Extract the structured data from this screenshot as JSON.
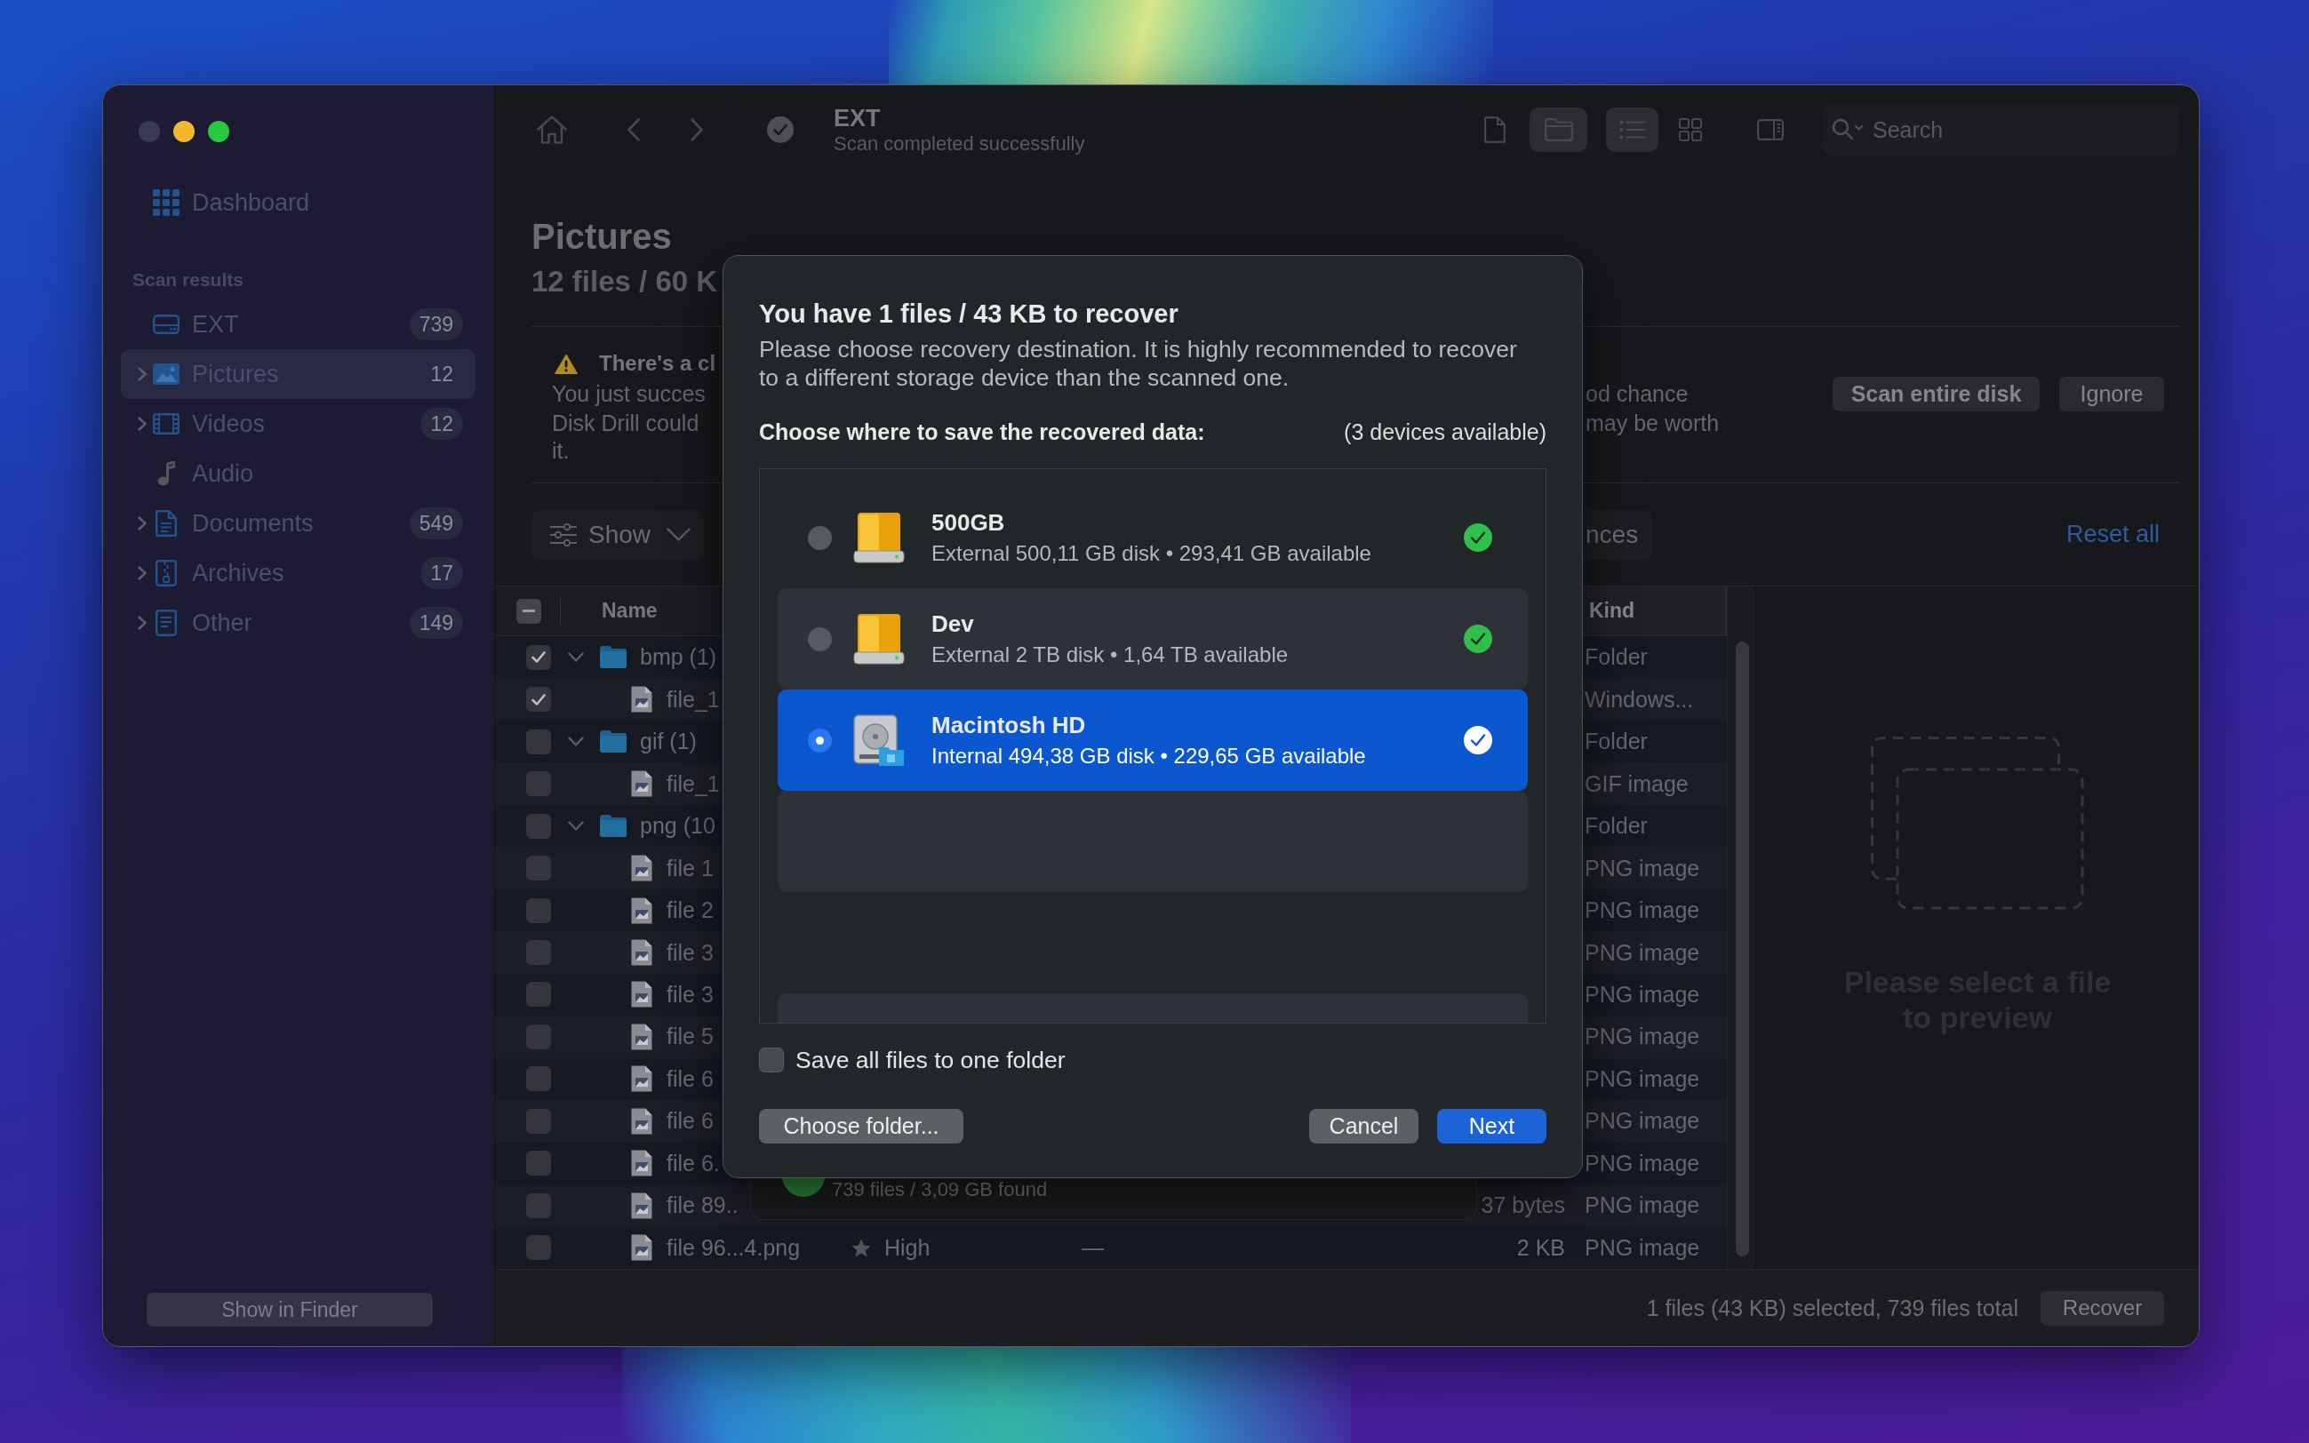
{
  "window": {
    "traffic_lights": [
      {
        "kind": "close",
        "disabled": true
      },
      {
        "kind": "minimize",
        "disabled": false
      },
      {
        "kind": "zoom",
        "disabled": false
      }
    ]
  },
  "sidebar": {
    "dashboard": {
      "label": "Dashboard",
      "selected": false
    },
    "section_title": "Scan results",
    "items": [
      {
        "kind": "drive",
        "label": "EXT",
        "count": "739",
        "selected": false
      },
      {
        "kind": "pictures",
        "label": "Pictures",
        "count": "12",
        "expanded": false,
        "selected": true
      },
      {
        "kind": "videos",
        "label": "Videos",
        "count": "12",
        "expanded": false,
        "selected": false
      },
      {
        "kind": "audio",
        "label": "Audio",
        "selected": false
      },
      {
        "kind": "documents",
        "label": "Documents",
        "count": "549",
        "expanded": false,
        "selected": false
      },
      {
        "kind": "archives",
        "label": "Archives",
        "count": "17",
        "expanded": false,
        "selected": false
      },
      {
        "kind": "other",
        "label": "Other",
        "count": "149",
        "expanded": false,
        "selected": false
      }
    ],
    "footer_button": "Show in Finder"
  },
  "toolbar": {
    "title": "EXT",
    "subtitle": "Scan completed successfully",
    "content_view": [
      {
        "kind": "files",
        "selected": false
      },
      {
        "kind": "folders",
        "selected": true
      }
    ],
    "layout_view": [
      {
        "kind": "list",
        "selected": true
      },
      {
        "kind": "grid",
        "selected": false
      }
    ],
    "search": {
      "placeholder": "Search"
    }
  },
  "header": {
    "title": "Pictures",
    "subtitle": "12 files / 60 K"
  },
  "notice": {
    "title": "There's a cl",
    "left_lines": [
      "You just succes",
      "Disk Drill could",
      "it."
    ],
    "right_lines": [
      "od chance",
      "may be worth"
    ],
    "buttons": [
      {
        "kind": "primary",
        "label": "Scan entire disk"
      },
      {
        "kind": "secondary",
        "label": "Ignore"
      }
    ]
  },
  "filters": {
    "show": "Show",
    "partial_button": "nces",
    "reset": "Reset all"
  },
  "table": {
    "header_checkbox": {
      "mixed": true
    },
    "columns": [
      "Name",
      "Kind"
    ],
    "rows": [
      {
        "kind": "folder",
        "name": "bmp (1)",
        "checked": true,
        "expanded": true,
        "kind_text": "Folder"
      },
      {
        "kind": "file",
        "name": "file_1",
        "checked": true,
        "kind_text": "Windows..."
      },
      {
        "kind": "folder",
        "name": "gif (1)",
        "checked": false,
        "expanded": true,
        "kind_text": "Folder"
      },
      {
        "kind": "file",
        "name": "file_1",
        "checked": false,
        "kind_text": "GIF image"
      },
      {
        "kind": "folder",
        "name": "png (10",
        "checked": false,
        "expanded": true,
        "kind_text": "Folder"
      },
      {
        "kind": "file",
        "name": "file 1",
        "checked": false,
        "kind_text": "PNG image"
      },
      {
        "kind": "file",
        "name": "file 2",
        "checked": false,
        "kind_text": "PNG image"
      },
      {
        "kind": "file",
        "name": "file 3",
        "checked": false,
        "kind_text": "PNG image"
      },
      {
        "kind": "file",
        "name": "file 3",
        "checked": false,
        "kind_text": "PNG image"
      },
      {
        "kind": "file",
        "name": "file 5",
        "checked": false,
        "kind_text": "PNG image"
      },
      {
        "kind": "file",
        "name": "file 6",
        "checked": false,
        "kind_text": "PNG image"
      },
      {
        "kind": "file",
        "name": "file 6",
        "checked": false,
        "kind_text": "PNG image"
      },
      {
        "kind": "file",
        "name": "file 6.",
        "checked": false,
        "kind_text": "PNG image"
      },
      {
        "kind": "file",
        "name": "file 89..",
        "checked": false,
        "size": "37 bytes",
        "kind_text": "PNG image"
      },
      {
        "kind": "file",
        "name": "file 96...4.png",
        "checked": false,
        "rating": "High",
        "date": "—",
        "size": "2 KB",
        "kind_text": "PNG image"
      }
    ]
  },
  "preview": {
    "message": "Please select a file to preview"
  },
  "status_bar": {
    "summary": "1 files (43 KB) selected, 739 files total",
    "button": "Recover"
  },
  "background_sheet": {
    "summary": "739 files / 3,09 GB found"
  },
  "dialog": {
    "title": "You have 1 files / 43 KB to recover",
    "message": "Please choose recovery destination. It is highly recommended to recover to a different storage device than the scanned one.",
    "prompt": "Choose where to save the recovered data:",
    "device_count": "(3 devices available)",
    "devices": [
      {
        "kind": "external",
        "name": "500GB",
        "details": "External 500,11 GB disk • 293,41 GB available",
        "selected": false,
        "available": true
      },
      {
        "kind": "external",
        "name": "Dev",
        "details": "External 2 TB disk • 1,64 TB available",
        "selected": false,
        "available": true
      },
      {
        "kind": "internal",
        "name": "Macintosh HD",
        "details": "Internal 494,38 GB disk • 229,65 GB available",
        "selected": true,
        "available": true
      }
    ],
    "save_to_one_folder": {
      "label": "Save all files to one folder",
      "checked": false
    },
    "buttons": [
      {
        "kind": "choose",
        "label": "Choose folder..."
      },
      {
        "kind": "cancel",
        "label": "Cancel"
      },
      {
        "kind": "confirm",
        "label": "Next"
      }
    ]
  }
}
